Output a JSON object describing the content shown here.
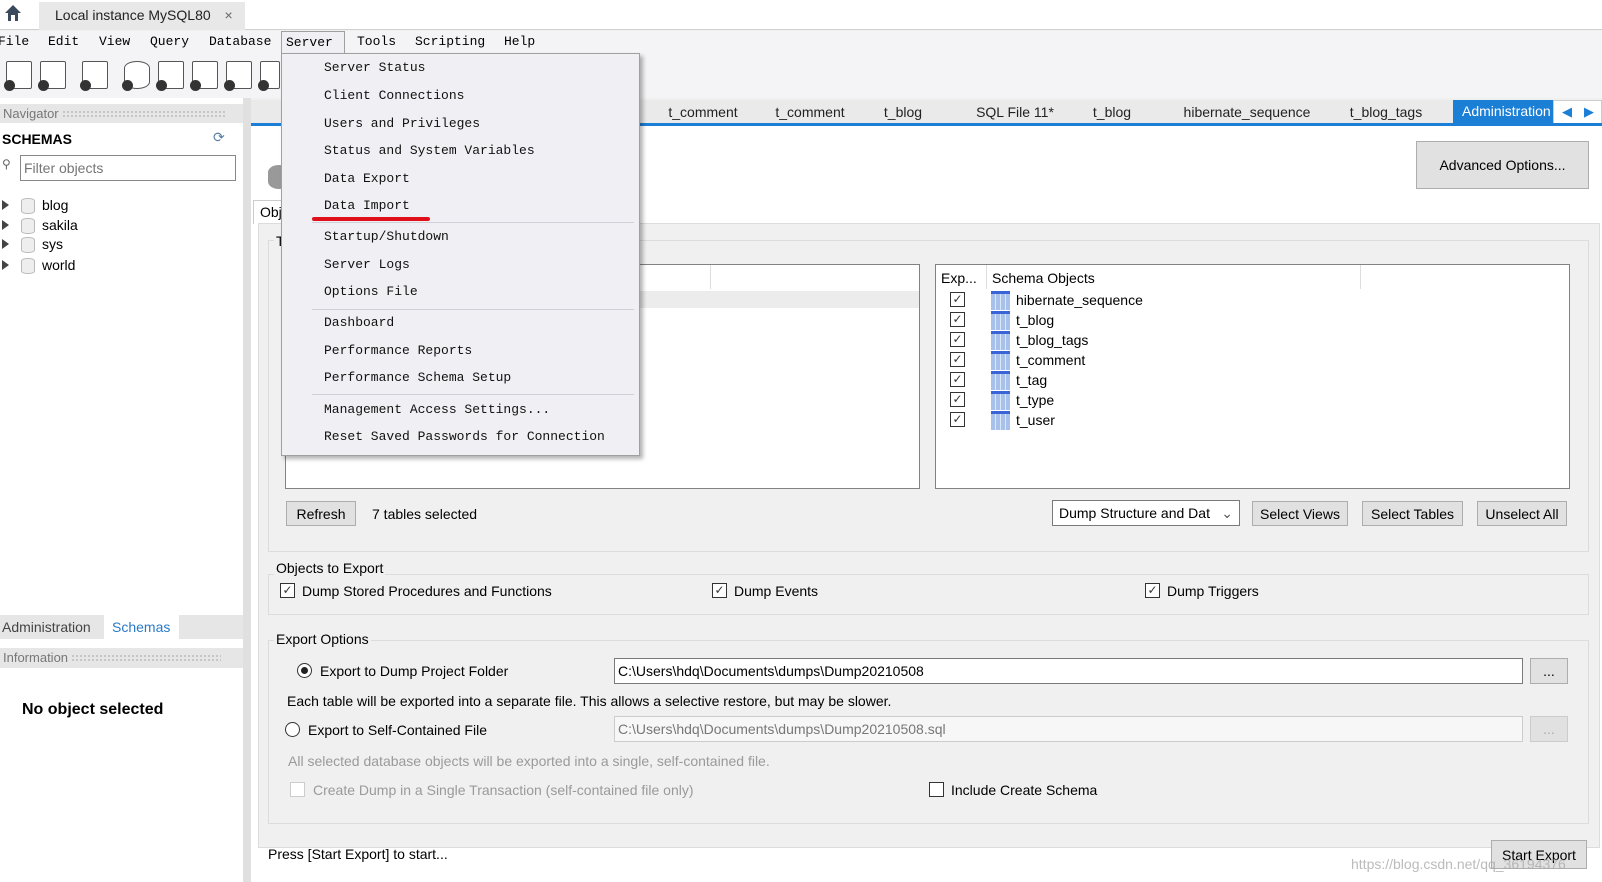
{
  "window": {
    "connection_tab": "Local instance MySQL80",
    "close_glyph": "×"
  },
  "menubar": [
    "File",
    "Edit",
    "View",
    "Query",
    "Database",
    "Server",
    "Tools",
    "Scripting",
    "Help"
  ],
  "server_menu": {
    "items": [
      "Server Status",
      "Client Connections",
      "Users and Privileges",
      "Status and System Variables",
      "Data Export",
      "Data Import",
      "Startup/Shutdown",
      "Server Logs",
      "Options File",
      "Dashboard",
      "Performance Reports",
      "Performance Schema Setup",
      "Management Access Settings...",
      "Reset Saved Passwords for Connection"
    ],
    "highlight_color": "#e0101a"
  },
  "navigator": {
    "title": "Navigator",
    "schemas_label": "SCHEMAS",
    "filter_placeholder": "Filter objects",
    "schemas": [
      "blog",
      "sakila",
      "sys",
      "world"
    ],
    "bottom_tabs": [
      "Administration",
      "Schemas"
    ],
    "information_title": "Information",
    "no_selection": "No object selected"
  },
  "editor_tabs": [
    "t_comment",
    "t_comment",
    "t_blog",
    "SQL File 11*",
    "t_blog",
    "hibernate_sequence",
    "t_blog_tags",
    "Administration"
  ],
  "accent_color": "#1b7fd6",
  "export": {
    "advanced_button": "Advanced Options...",
    "object_tab": "Obj",
    "tables_group": "T",
    "right_list": {
      "col_export": "Exp...",
      "col_objects": "Schema Objects",
      "rows": [
        {
          "name": "hibernate_sequence",
          "checked": true
        },
        {
          "name": "t_blog",
          "checked": true
        },
        {
          "name": "t_blog_tags",
          "checked": true
        },
        {
          "name": "t_comment",
          "checked": true
        },
        {
          "name": "t_tag",
          "checked": true
        },
        {
          "name": "t_type",
          "checked": true
        },
        {
          "name": "t_user",
          "checked": true
        }
      ]
    },
    "refresh_button": "Refresh",
    "selected_count": "7 tables selected",
    "dump_mode": "Dump Structure and Dat",
    "select_views": "Select Views",
    "select_tables": "Select Tables",
    "unselect_all": "Unselect All",
    "objects_group": "Objects to Export",
    "dump_routines": "Dump Stored Procedures and Functions",
    "dump_events": "Dump Events",
    "dump_triggers": "Dump Triggers",
    "options_group": "Export Options",
    "opt_folder": "Export to Dump Project Folder",
    "folder_path": "C:\\Users\\hdq\\Documents\\dumps\\Dump20210508",
    "browse": "...",
    "folder_note": "Each table will be exported into a separate file. This allows a selective restore, but may be slower.",
    "opt_file": "Export to Self-Contained File",
    "file_path": "C:\\Users\\hdq\\Documents\\dumps\\Dump20210508.sql",
    "file_note": "All selected database objects will be exported into a single, self-contained file.",
    "single_txn": "Create Dump in a Single Transaction (self-contained file only)",
    "include_schema": "Include Create Schema",
    "status": "Press [Start Export] to start...",
    "start_button": "Start Export"
  },
  "watermark": "https://blog.csdn.net/qq_36194376"
}
